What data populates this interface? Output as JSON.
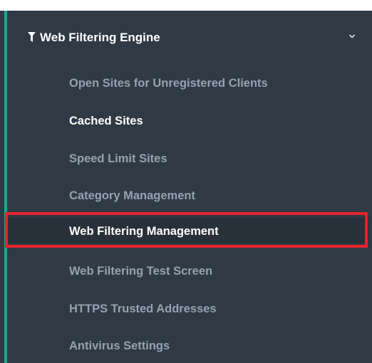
{
  "section": {
    "title": "Web Filtering Engine",
    "icon": "filter-icon",
    "expand_icon": "chevron-down-icon"
  },
  "menu": {
    "items": [
      {
        "label": "Open Sites for Unregistered Clients",
        "state": "normal"
      },
      {
        "label": "Cached Sites",
        "state": "active"
      },
      {
        "label": "Speed Limit Sites",
        "state": "normal"
      },
      {
        "label": "Category Management",
        "state": "normal"
      },
      {
        "label": "Web Filtering Management",
        "state": "highlighted"
      },
      {
        "label": "Web Filtering Test Screen",
        "state": "normal"
      },
      {
        "label": "HTTPS Trusted Addresses",
        "state": "normal"
      },
      {
        "label": "Antivirus Settings",
        "state": "normal"
      }
    ]
  },
  "colors": {
    "sidebar_bg": "#2f3a45",
    "accent": "#1aa692",
    "item_text": "#95a2af",
    "active_text": "#ffffff",
    "highlight_border": "#e8222a"
  }
}
